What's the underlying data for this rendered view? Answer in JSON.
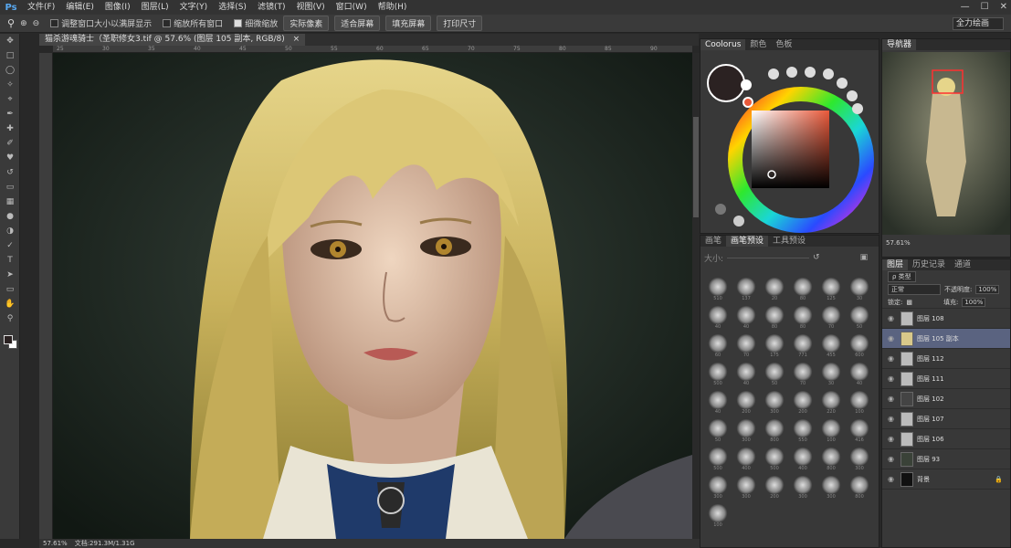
{
  "app": {
    "logo": "Ps"
  },
  "menu": [
    "文件(F)",
    "编辑(E)",
    "图像(I)",
    "图层(L)",
    "文字(Y)",
    "选择(S)",
    "滤镜(T)",
    "视图(V)",
    "窗口(W)",
    "帮助(H)"
  ],
  "window_controls": [
    "—",
    "☐",
    "✕"
  ],
  "options_bar": {
    "resize_windows": "调整窗口大小以满屏显示",
    "zoom_all": "缩放所有窗口",
    "scrubby_zoom": "细微缩放",
    "actual_pixels": "实际像素",
    "fit_screen": "适合屏幕",
    "fill_screen": "填充屏幕",
    "print_size": "打印尺寸",
    "workspace": "全力绘画"
  },
  "document": {
    "tab_title": "猫杀游魂骑士（圣职修女3.tif @ 57.6% (图层 105 副本, RGB/8)",
    "tab_close": "×",
    "ruler_ticks": [
      "25",
      "30",
      "35",
      "40",
      "45",
      "50",
      "55",
      "60",
      "65",
      "70",
      "75",
      "80",
      "85",
      "90"
    ]
  },
  "status": {
    "zoom": "57.61%",
    "doc_size": "文档:291.3M/1.31G"
  },
  "colors": {
    "foreground": "#2b2222",
    "background": "#ffffff",
    "accent": "#e9593a",
    "selected_layer": "#5a6380"
  },
  "coolorus": {
    "tabs": [
      "Coolorus",
      "颜色",
      "色板"
    ]
  },
  "brushes": {
    "tabs": [
      "画笔",
      "画笔预设",
      "工具预设"
    ],
    "size_label": "大小:",
    "sizes": [
      "510",
      "137",
      "20",
      "80",
      "125",
      "30",
      "40",
      "40",
      "80",
      "80",
      "70",
      "50",
      "60",
      "70",
      "175",
      "771",
      "455",
      "600",
      "500",
      "40",
      "50",
      "70",
      "30",
      "40",
      "40",
      "200",
      "300",
      "200",
      "220",
      "100",
      "50",
      "300",
      "800",
      "550",
      "100",
      "416",
      "500",
      "400",
      "500",
      "400",
      "800",
      "300",
      "300",
      "300",
      "200",
      "300",
      "300",
      "800",
      "100"
    ]
  },
  "navigator": {
    "title": "导航器",
    "zoom": "57.61%"
  },
  "layers": {
    "tabs": [
      "图层",
      "历史记录",
      "通道"
    ],
    "kind_label": "ρ 类型",
    "blend_mode": "正常",
    "opacity_label": "不透明度:",
    "opacity": "100%",
    "lock_label": "锁定:",
    "fill_label": "填充:",
    "fill": "100%",
    "items": [
      {
        "name": "图层 108"
      },
      {
        "name": "图层 105 副本"
      },
      {
        "name": "图层 112"
      },
      {
        "name": "图层 111"
      },
      {
        "name": "图层 102"
      },
      {
        "name": "图层 107"
      },
      {
        "name": "图层 106"
      },
      {
        "name": "图层 93"
      },
      {
        "name": "背景"
      }
    ]
  }
}
